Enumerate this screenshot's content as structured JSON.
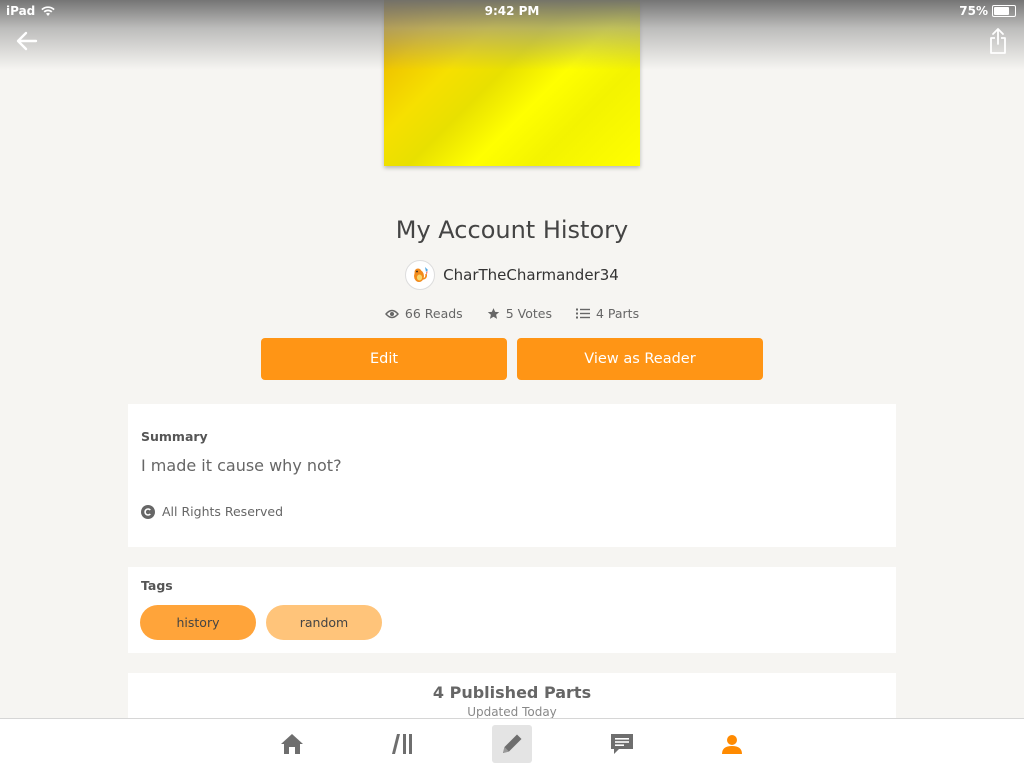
{
  "status_bar": {
    "device": "iPad",
    "time": "9:42 PM",
    "battery": "75%"
  },
  "nav": {
    "back_icon": "arrow-left-icon",
    "share_icon": "share-icon"
  },
  "story": {
    "title": "My Account History",
    "author": "CharTheCharmander34",
    "reads": "66 Reads",
    "votes": "5 Votes",
    "parts": "4 Parts"
  },
  "actions": {
    "edit": "Edit",
    "view_as_reader": "View as Reader"
  },
  "summary": {
    "label": "Summary",
    "text": "I made it cause why not?",
    "rights": "All Rights Reserved"
  },
  "tags": {
    "label": "Tags",
    "items": [
      "history",
      "random"
    ]
  },
  "published": {
    "title": "4 Published Parts",
    "updated": "Updated Today"
  },
  "tabbar": {
    "items": [
      "home-icon",
      "library-icon",
      "write-icon",
      "messages-icon",
      "profile-icon"
    ],
    "active": "write-icon"
  },
  "colors": {
    "accent": "#ff9515",
    "tag_primary": "#ffa43a",
    "tag_secondary": "#ffc47a",
    "profile_active": "#ff8a00"
  }
}
